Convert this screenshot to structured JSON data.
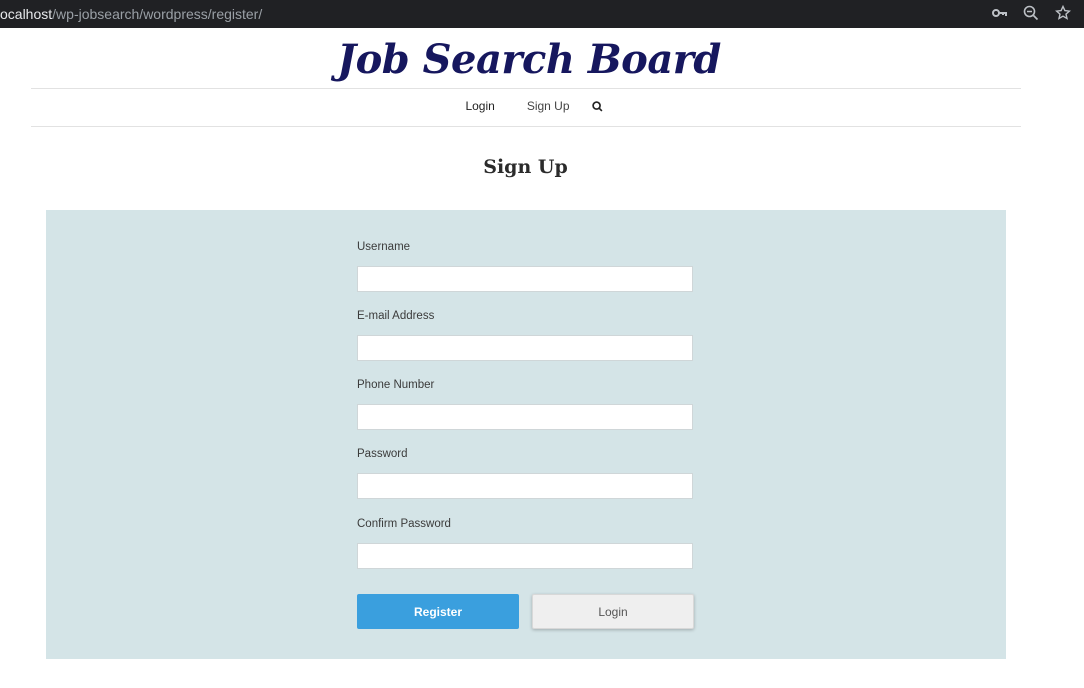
{
  "browser": {
    "url_host": "ocalhost",
    "url_path": "/wp-jobsearch/wordpress/register/",
    "icons": [
      "key-icon",
      "zoom-out-icon",
      "star-icon"
    ]
  },
  "site": {
    "title": "Job Search Board",
    "title_color": "#16175e"
  },
  "nav": {
    "items": [
      {
        "label": "Login"
      },
      {
        "label": "Sign Up"
      }
    ],
    "search_icon": "search-icon"
  },
  "page": {
    "title": "Sign Up"
  },
  "form": {
    "panel_color": "#d4e4e7",
    "fields": [
      {
        "label": "Username",
        "value": ""
      },
      {
        "label": "E-mail Address",
        "value": ""
      },
      {
        "label": "Phone Number",
        "value": ""
      },
      {
        "label": "Password",
        "value": ""
      },
      {
        "label": "Confirm Password",
        "value": ""
      }
    ],
    "register_label": "Register",
    "login_label": "Login",
    "accent_color": "#3a9fde"
  }
}
